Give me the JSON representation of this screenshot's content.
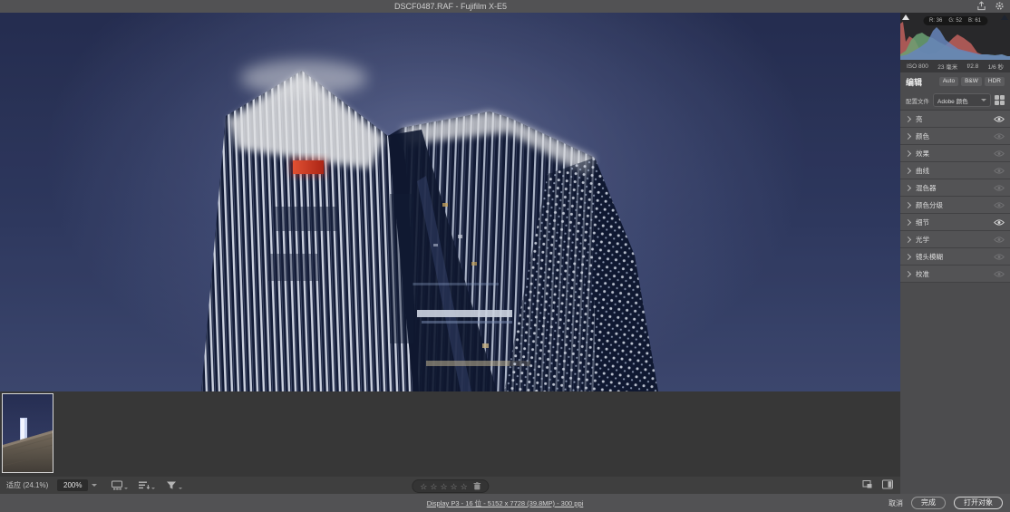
{
  "window": {
    "title": "DSCF0487.RAF  -  Fujifilm X-E5"
  },
  "histogram": {
    "r": "R: 36",
    "g": "G: 52",
    "b": "B: 61"
  },
  "exif": {
    "iso": "ISO 800",
    "focal_length": "23 毫米",
    "aperture": "f/2.8",
    "shutter": "1/6 秒"
  },
  "edit": {
    "title": "编辑",
    "auto": "Auto",
    "bw": "B&W",
    "hdr": "HDR"
  },
  "profile": {
    "label": "配置文件",
    "value": "Adobe 颜色"
  },
  "panels": [
    {
      "label": "亮",
      "eye": "on"
    },
    {
      "label": "颜色",
      "eye": "off"
    },
    {
      "label": "效果",
      "eye": "off"
    },
    {
      "label": "曲线",
      "eye": "off"
    },
    {
      "label": "混色器",
      "eye": "off"
    },
    {
      "label": "颜色分级",
      "eye": "off"
    },
    {
      "label": "细节",
      "eye": "on"
    },
    {
      "label": "光学",
      "eye": "off"
    },
    {
      "label": "镜头模糊",
      "eye": "off"
    },
    {
      "label": "校准",
      "eye": "off"
    }
  ],
  "toolbar": {
    "fit": "适应 (24.1%)",
    "zoom": "200%"
  },
  "rating": {
    "star": "☆",
    "stars_count": 5
  },
  "statusbar": {
    "info_link": "Display P3 - 16 位 - 5152 x 7728 (39.8MP) - 300 ppi",
    "cancel": "取消",
    "done": "完成",
    "open_object": "打开对象"
  },
  "colors": {
    "sky_top": "#293156",
    "sky_bottom": "#434e78",
    "building_stripe": "#e6ecfa",
    "red_sign": "#e8402c",
    "panel_bg": "#4c4c4e",
    "accent_border": "#d8d8d8"
  }
}
